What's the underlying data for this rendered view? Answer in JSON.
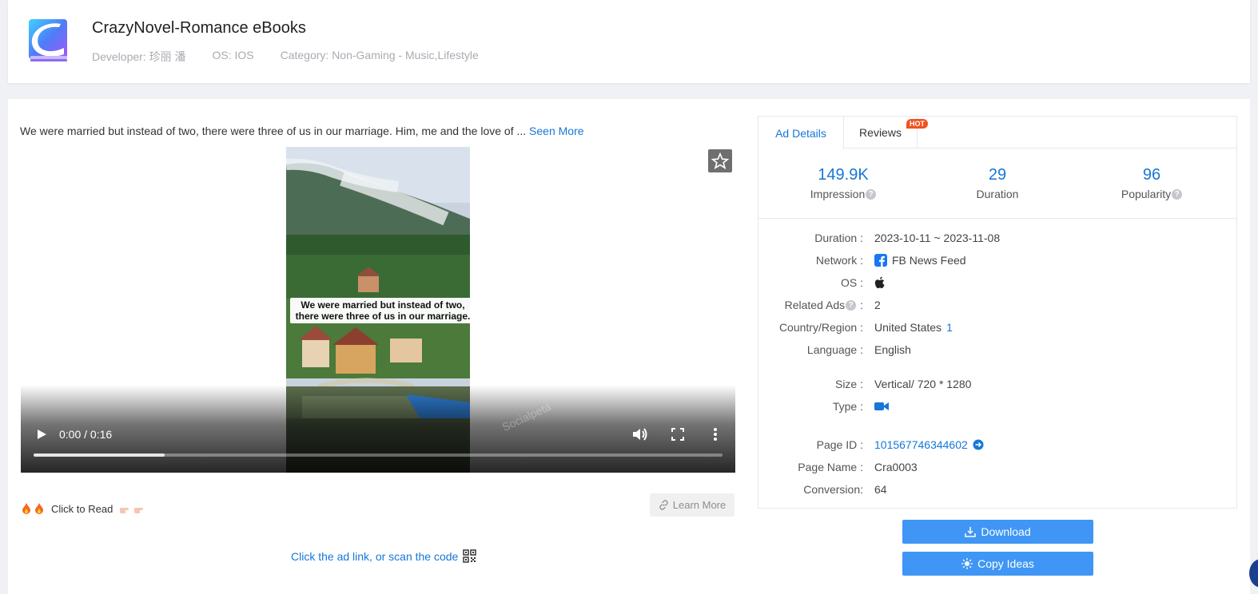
{
  "app": {
    "title": "CrazyNovel-Romance eBooks",
    "developer": "Developer: 珍丽 潘",
    "os": "OS: IOS",
    "category": "Category: Non-Gaming - Music,Lifestyle",
    "logo_icon": "book-logo-icon"
  },
  "ad": {
    "description": "We were married but instead of two, there were three of us in our marriage. Him, me and the love of ...",
    "seen_more": "Seen More",
    "video_caption": "We were married but instead of two, there were three of us in our marriage.",
    "watermark": "Socialpeta",
    "video_time": "0:00 / 0:16",
    "video_progress": 0.19,
    "cta_text": "Click to Read",
    "learn_more": "Learn More",
    "scan_text": "Click the ad link, or scan the code"
  },
  "panel": {
    "tabs": [
      "Ad Details",
      "Reviews"
    ],
    "hot_badge": "HOT",
    "stats": [
      {
        "value": "149.9K",
        "label": "Impression"
      },
      {
        "value": "29",
        "label": "Duration"
      },
      {
        "value": "96",
        "label": "Popularity"
      }
    ],
    "details": {
      "duration_label": "Duration :",
      "duration_value": "2023-10-11 ~ 2023-11-08",
      "network_label": "Network :",
      "network_value": "FB News Feed",
      "os_label": "OS :",
      "related_label": "Related Ads",
      "related_colon": ":",
      "related_value": "2",
      "country_label": "Country/Region :",
      "country_value": "United States",
      "country_count": "1",
      "language_label": "Language :",
      "language_value": "English",
      "size_label": "Size :",
      "size_value": "Vertical/ 720 * 1280",
      "type_label": "Type :",
      "page_id_label": "Page ID :",
      "page_id_value": "101567746344602",
      "page_name_label": "Page Name :",
      "page_name_value": "Cra0003",
      "conversion_label": "Conversion:",
      "conversion_value": "64"
    },
    "download_button": "Download",
    "copy_button": "Copy Ideas"
  },
  "colors": {
    "accent": "#1677d8",
    "button": "#3f96f4",
    "hot": "#f1521e"
  }
}
